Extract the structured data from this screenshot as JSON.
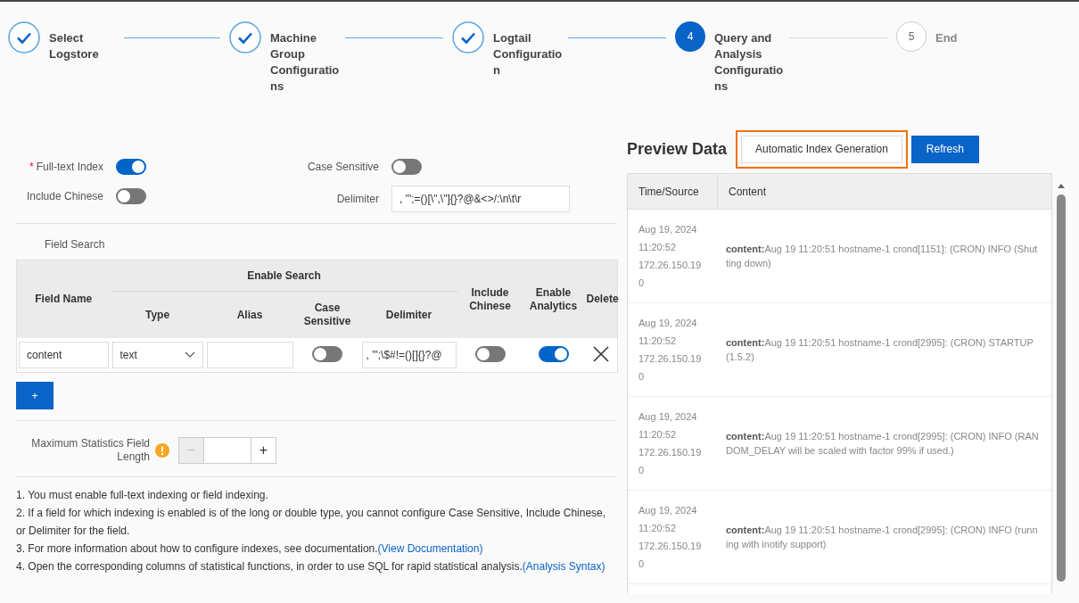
{
  "steps": [
    {
      "label": "Select Logstore",
      "done": true,
      "selected": false
    },
    {
      "label": "Machine Group Configurations",
      "done": true,
      "selected": false
    },
    {
      "label": "Logtail Configuration",
      "done": true,
      "selected": false
    },
    {
      "number": "4",
      "label": "Query and Analysis Configurations",
      "done": false,
      "selected": true
    },
    {
      "number": "5",
      "label": "End",
      "done": false,
      "selected": false
    }
  ],
  "full_text": {
    "switches": [
      {
        "required_mark": "*",
        "label": "Full-text Index",
        "on": true
      },
      {
        "label": "Include Chinese",
        "on": false
      },
      {
        "label": "Case Sensitive",
        "on": false
      }
    ],
    "delimiter": {
      "label": "Delimiter",
      "value": ", '\";=()[\\\",\\\"]{}?@&<>/:\\n\\t\\r"
    }
  },
  "field_search": {
    "label": "Field Search",
    "group_header": "Enable Search",
    "columns": [
      "Field Name",
      "Type",
      "Alias",
      "Case Sensitive",
      "Delimiter",
      "Include Chinese",
      "Enable Analytics",
      "Delete"
    ],
    "rows": [
      {
        "field_name": "content",
        "type": "text",
        "case_sensitive": false,
        "delimiter": ", '\";\\$#!=()[]{}?@",
        "include_chinese": false,
        "enable_analytics": true
      }
    ],
    "add_button": "+"
  },
  "max_stats": {
    "label": "Maximum Statistics Field Length",
    "minus": "−",
    "plus": "+",
    "minus_disabled": true
  },
  "notes": [
    {
      "text": "1. You must enable full-text indexing or field indexing."
    },
    {
      "text": "2. If a field for which indexing is enabled is of the long or double type, you cannot configure Case Sensitive, Include Chinese, or Delimiter for the field."
    },
    {
      "text": "3. For more information about how to configure indexes, see documentation.",
      "link": "(View Documentation)"
    },
    {
      "text": "4. Open the corresponding columns of statistical functions, in order to use SQL for rapid statistical analysis.",
      "link": "(Analysis Syntax)"
    }
  ],
  "preview": {
    "title": "Preview Data",
    "buttons": [
      {
        "label": "Automatic Index Generation",
        "kind": "default",
        "highlighted": true
      },
      {
        "label": "Refresh",
        "kind": "primary",
        "highlighted": false
      }
    ],
    "columns": [
      "Time/Source",
      "Content"
    ],
    "rows": [
      {
        "time": "Aug 19, 2024 11:20:52 172.26.150.190",
        "content": "**content:**Aug 19 11:20:51 hostname-1 crond[1151]: (CRON) INFO (Shutting down)"
      },
      {
        "time": "Aug 19, 2024 11:20:52 172.26.150.190",
        "content": "**content:**Aug 19 11:20:51 hostname-1 crond[2995]: (CRON) STARTUP (1.5.2)"
      },
      {
        "time": "Aug 19, 2024 11:20:52 172.26.150.190",
        "content": "**content:**Aug 19 11:20:51 hostname-1 crond[2995]: (CRON) INFO (RANDOM_DELAY will be scaled with factor 99% if used.)"
      },
      {
        "time": "Aug 19, 2024 11:20:52 172.26.150.190",
        "content": "**content:**Aug 19 11:20:51 hostname-1 crond[2995]: (CRON) INFO (running with inotify support)"
      }
    ]
  }
}
